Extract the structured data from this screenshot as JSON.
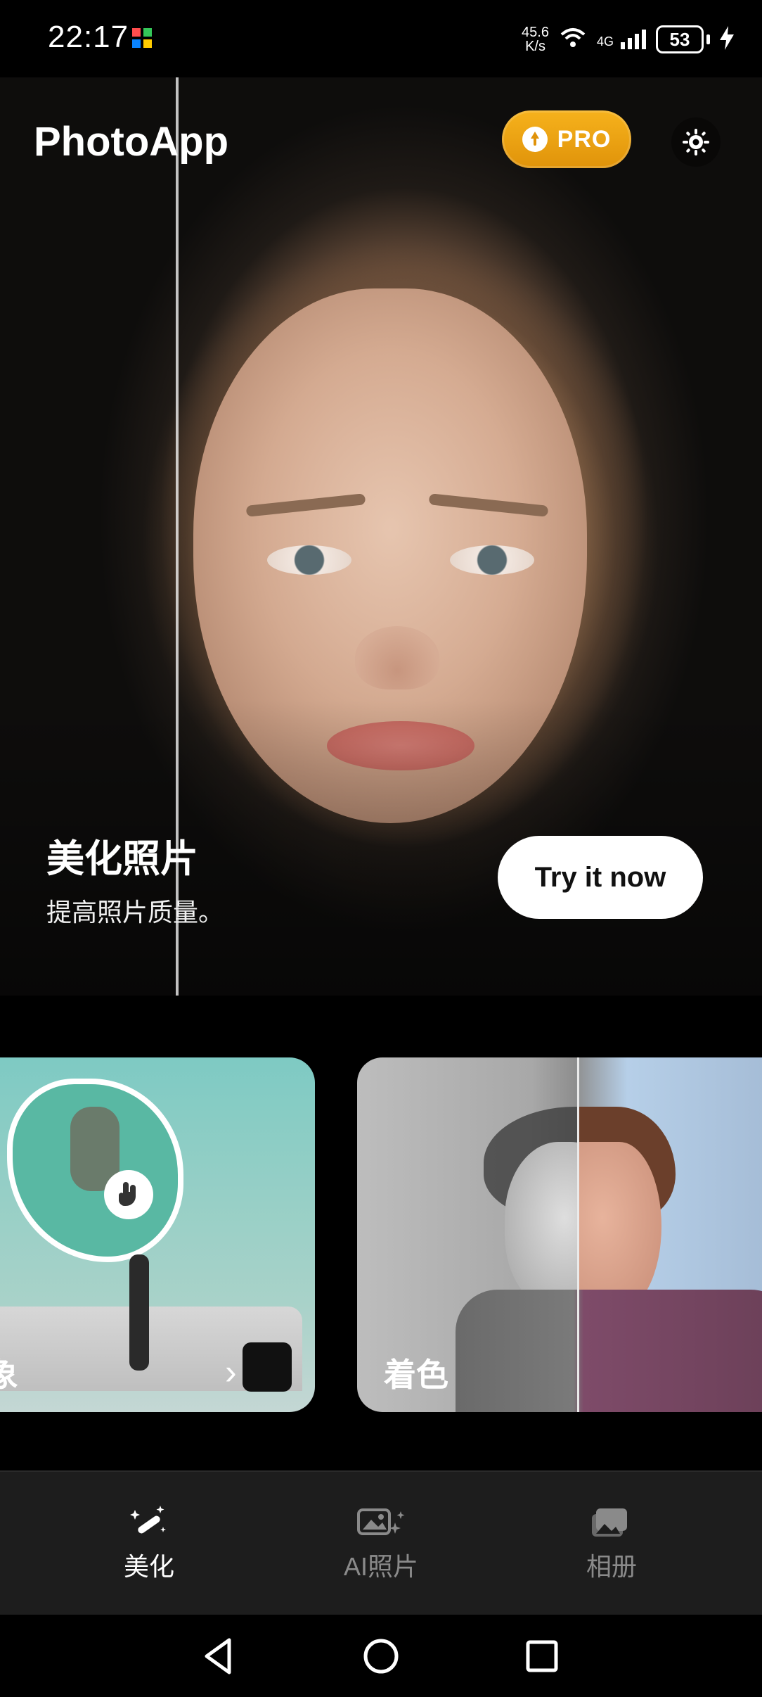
{
  "status_bar": {
    "time": "22:17",
    "net_speed_value": "45.6",
    "net_speed_unit": "K/s",
    "network_label": "4G",
    "battery": "53",
    "icons": [
      "wifi-icon",
      "signal-icon",
      "charging-icon",
      "app-badge-icon"
    ]
  },
  "header": {
    "app_title": "PhotoApp",
    "pro_label": "PRO",
    "settings_icon": "gear-icon"
  },
  "hero": {
    "title": "美化照片",
    "subtitle": "提高照片质量。",
    "cta": "Try it now"
  },
  "cards": [
    {
      "label": "象",
      "name": "cutout"
    },
    {
      "label": "着色",
      "name": "colorize"
    }
  ],
  "bottom_nav": [
    {
      "label": "美化",
      "icon": "magic-wand-icon",
      "active": true
    },
    {
      "label": "AI照片",
      "icon": "ai-photos-icon",
      "active": false
    },
    {
      "label": "相册",
      "icon": "album-icon",
      "active": false
    }
  ],
  "system_nav": [
    "back-icon",
    "home-icon",
    "recents-icon"
  ]
}
